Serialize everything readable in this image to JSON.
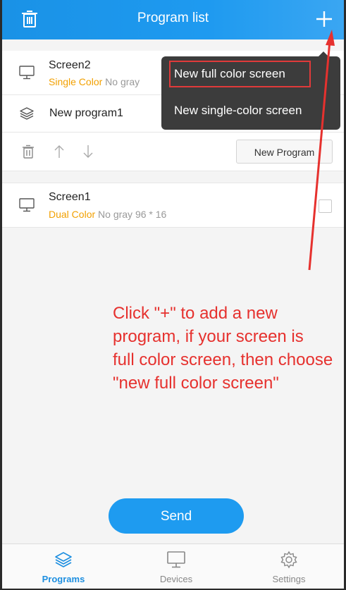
{
  "header": {
    "title": "Program list"
  },
  "programs": [
    {
      "name": "Screen2",
      "color_type": "Single Color",
      "gray": "No gray"
    },
    {
      "name": "Screen1",
      "color_type": "Dual Color",
      "gray": "No gray",
      "size": "96 * 16"
    }
  ],
  "program_item": {
    "name": "New program1"
  },
  "toolbar": {
    "new_program_label": "New Program"
  },
  "popup_menu": {
    "items": [
      "New full color screen",
      "New single-color screen"
    ]
  },
  "annotation": {
    "lines": [
      "Click \"+\" to add a new",
      "program, if your screen is",
      "full color screen, then choose",
      "\"new full color screen\""
    ]
  },
  "send_label": "Send",
  "tabbar": {
    "tabs": [
      {
        "label": "Programs",
        "icon": "layers-icon",
        "active": true
      },
      {
        "label": "Devices",
        "icon": "monitor-icon",
        "active": false
      },
      {
        "label": "Settings",
        "icon": "gear-icon",
        "active": false
      }
    ]
  },
  "colors": {
    "header_blue": "#1e9af0",
    "accent_yellow": "#f2a000",
    "annotation_red": "#e6312e",
    "tab_active": "#1e8fe0"
  }
}
